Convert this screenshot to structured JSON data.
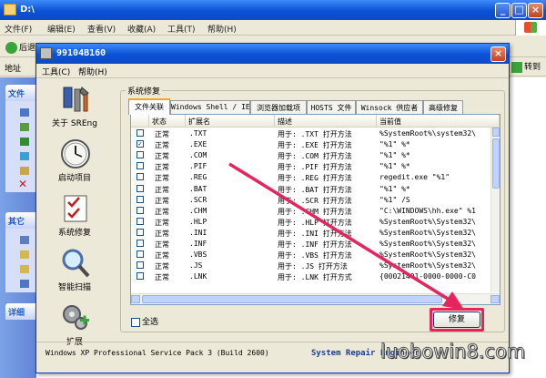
{
  "background_window": {
    "title": "D:\\",
    "menu": [
      "文件(F)",
      "编辑(E)",
      "查看(V)",
      "收藏(A)",
      "工具(T)",
      "帮助(H)"
    ],
    "back_label": "后退",
    "address_label": "地址",
    "go_label": "转到",
    "side_sections": [
      "文件",
      "其它",
      "详细"
    ]
  },
  "window": {
    "title": "99104B160",
    "menu": [
      "工具(C)",
      "帮助(H)"
    ]
  },
  "nav": [
    {
      "label": "关于 SREng",
      "icon": "tools-icon"
    },
    {
      "label": "启动项目",
      "icon": "clock-icon"
    },
    {
      "label": "系统修复",
      "icon": "checklist-icon"
    },
    {
      "label": "智能扫描",
      "icon": "magnifier-icon"
    },
    {
      "label": "扩展",
      "icon": "gears-icon"
    }
  ],
  "group_title": "系统修复",
  "tabs": [
    {
      "label": "文件关联",
      "active": true
    },
    {
      "label": "Windows Shell / IE",
      "active": false
    },
    {
      "label": "浏览器加载项",
      "active": false
    },
    {
      "label": "HOSTS 文件",
      "active": false
    },
    {
      "label": "Winsock 供应者",
      "active": false
    },
    {
      "label": "高级修复",
      "active": false
    }
  ],
  "columns": [
    "状态",
    "扩展名",
    "描述",
    "当前值"
  ],
  "rows": [
    {
      "checked": false,
      "status": "正常",
      "ext": ".TXT",
      "desc": "用于: .TXT 打开方法",
      "value": "%SystemRoot%\\system32\\"
    },
    {
      "checked": true,
      "status": "正常",
      "ext": ".EXE",
      "desc": "用于: .EXE 打开方法",
      "value": "\"%1\" %*"
    },
    {
      "checked": false,
      "status": "正常",
      "ext": ".COM",
      "desc": "用于: .COM 打开方法",
      "value": "\"%1\" %*"
    },
    {
      "checked": false,
      "status": "正常",
      "ext": ".PIF",
      "desc": "用于: .PIF 打开方法",
      "value": "\"%1\" %*"
    },
    {
      "checked": false,
      "status": "正常",
      "ext": ".REG",
      "desc": "用于: .REG 打开方法",
      "value": "regedit.exe \"%1\""
    },
    {
      "checked": false,
      "status": "正常",
      "ext": ".BAT",
      "desc": "用于: .BAT 打开方法",
      "value": "\"%1\" %*"
    },
    {
      "checked": false,
      "status": "正常",
      "ext": ".SCR",
      "desc": "用于: .SCR 打开方法",
      "value": "\"%1\" /S"
    },
    {
      "checked": false,
      "status": "正常",
      "ext": ".CHM",
      "desc": "用于: .CHM 打开方法",
      "value": "\"C:\\WINDOWS\\hh.exe\" %1"
    },
    {
      "checked": false,
      "status": "正常",
      "ext": ".HLP",
      "desc": "用于: .HLP 打开方法",
      "value": "%SystemRoot%\\System32\\"
    },
    {
      "checked": false,
      "status": "正常",
      "ext": ".INI",
      "desc": "用于: .INI 打开方法",
      "value": "%SystemRoot%\\System32\\"
    },
    {
      "checked": false,
      "status": "正常",
      "ext": ".INF",
      "desc": "用于: .INF 打开方法",
      "value": "%SystemRoot%\\System32\\"
    },
    {
      "checked": false,
      "status": "正常",
      "ext": ".VBS",
      "desc": "用于: .VBS 打开方法",
      "value": "%SystemRoot%\\System32\\"
    },
    {
      "checked": false,
      "status": "正常",
      "ext": ".JS",
      "desc": "用于: .JS 打开方法",
      "value": "%SystemRoot%\\System32\\"
    },
    {
      "checked": false,
      "status": "正常",
      "ext": ".LNK",
      "desc": "用于: .LNK 打开方式",
      "value": "{00021401-0000-0000-C0"
    }
  ],
  "select_all_label": "全选",
  "repair_label": "修复",
  "status_left": "Windows XP Professional Service Pack 3 (Build 2600)",
  "status_right": "System Repair Engineer",
  "watermark": "luobowin8.com",
  "colors": {
    "highlight": "#e8245e",
    "xp_title": "#0a52d6",
    "accent_tab": "#f5a623"
  }
}
